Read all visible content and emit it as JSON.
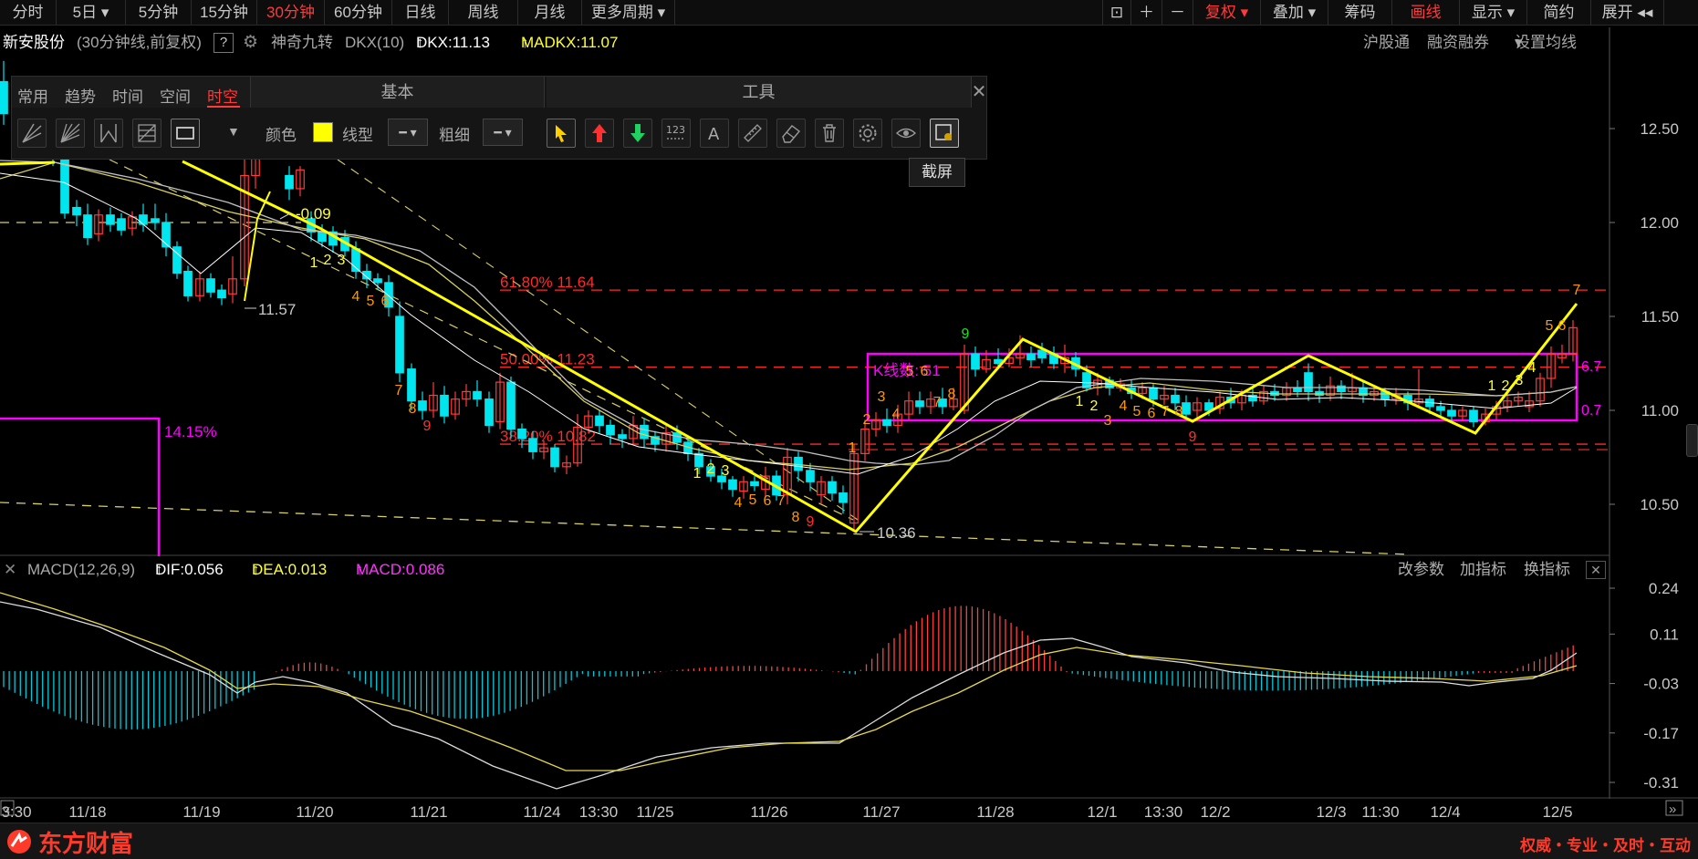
{
  "toolbar": {
    "periods": [
      "分时",
      "5日",
      "5分钟",
      "15分钟",
      "30分钟",
      "60分钟",
      "日线",
      "周线",
      "月线",
      "更多周期"
    ],
    "active_period": "30分钟",
    "right_buttons": [
      "复权",
      "叠加",
      "筹码",
      "画线",
      "显示",
      "简约",
      "展开"
    ]
  },
  "info": {
    "stock": "新安股份",
    "mode": "(30分钟线,前复权)",
    "help": "?",
    "indicator": "神奇九转",
    "dkx_label": "DKX(10)",
    "dkx_value": "DKX:11.13",
    "madkx_value": "MADKX:11.07",
    "links": [
      "沪股通",
      "融资融券",
      "设置均线"
    ]
  },
  "draw_panel": {
    "tabs": [
      "常用",
      "趋势",
      "时间",
      "空间",
      "时空"
    ],
    "active_tab": "时空",
    "basic_title": "基本",
    "tools_title": "工具",
    "color_label": "颜色",
    "line_type_label": "线型",
    "thickness_label": "粗细",
    "tooltip": "截屏",
    "color": "#ffff00",
    "tool_icons": [
      "cursor-icon",
      "up-arrow-icon",
      "down-arrow-icon",
      "number-icon",
      "text-icon",
      "ruler-icon",
      "eraser-icon",
      "trash-icon",
      "gear-icon",
      "eye-icon",
      "screenshot-icon"
    ]
  },
  "chart_data": [
    {
      "type": "candlestick",
      "y_ticks": [
        "12.50",
        "12.00",
        "11.50",
        "11.00",
        "10.50"
      ],
      "ylim": [
        10.25,
        12.95
      ],
      "x_ticks": [
        "3:30",
        "11/18",
        "11/19",
        "11/20",
        "11/21",
        "11/24",
        "13:30",
        "11/25",
        "11/26",
        "11/27",
        "11/28",
        "12/1",
        "13:30",
        "12/2",
        "12/3",
        "11:30",
        "12/4",
        "12/5"
      ],
      "annotations": {
        "price_labels": [
          "-0.09",
          "11.57",
          "10.36"
        ],
        "fib_labels": [
          "61.80% 11.64",
          "50.00% 11.23",
          "38.20% 10.82"
        ],
        "fib_levels": [
          11.64,
          11.23,
          10.82
        ],
        "box_label": "K线数: 51",
        "box_right_labels": [
          "6.7",
          "0.7"
        ],
        "percent_label": "14.15%",
        "count_labels": [
          "1",
          "2",
          "3",
          "4",
          "5",
          "6",
          "7",
          "8",
          "9"
        ]
      },
      "colors": {
        "up": "#ff3b3b",
        "down": "#00e5ee",
        "fib": "#ff2a2a",
        "box": "#ff00ff",
        "zigzag": "#ffff00"
      }
    },
    {
      "type": "macd",
      "title": "MACD(12,26,9)",
      "dif": "DIF:0.056",
      "dea": "DEA:0.013",
      "macd": "MACD:0.086",
      "y_ticks": [
        "0.24",
        "0.11",
        "-0.03",
        "-0.17",
        "-0.31"
      ],
      "ylim": [
        -0.31,
        0.24
      ],
      "buttons": [
        "改参数",
        "加指标",
        "换指标"
      ]
    }
  ],
  "bottom": {
    "brand": "东方财富",
    "slogan": "权威・专业・及时・互动"
  }
}
